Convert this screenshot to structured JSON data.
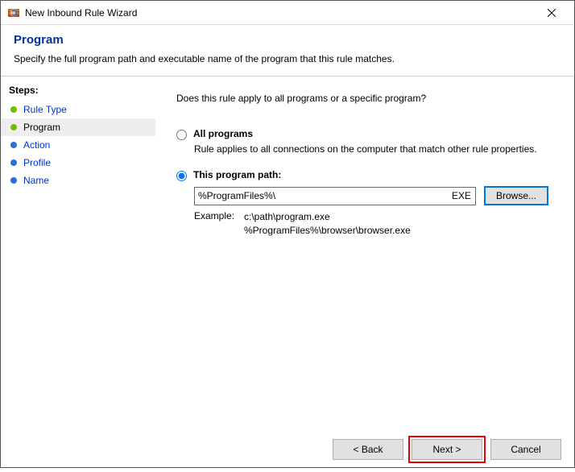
{
  "window": {
    "title": "New Inbound Rule Wizard"
  },
  "header": {
    "title": "Program",
    "description": "Specify the full program path and executable name of the program that this rule matches."
  },
  "steps": {
    "label": "Steps:",
    "items": [
      {
        "label": "Rule Type",
        "state": "done"
      },
      {
        "label": "Program",
        "state": "current"
      },
      {
        "label": "Action",
        "state": "future"
      },
      {
        "label": "Profile",
        "state": "future"
      },
      {
        "label": "Name",
        "state": "future"
      }
    ]
  },
  "content": {
    "question": "Does this rule apply to all programs or a specific program?",
    "option_all": {
      "label": "All programs",
      "sub": "Rule applies to all connections on the computer that match other rule properties."
    },
    "option_path": {
      "label": "This program path:",
      "value": "%ProgramFiles%\\",
      "ext": "EXE",
      "browse": "Browse...",
      "example_label": "Example:",
      "example_line1": "c:\\path\\program.exe",
      "example_line2": "%ProgramFiles%\\browser\\browser.exe"
    }
  },
  "buttons": {
    "back": "< Back",
    "next": "Next >",
    "cancel": "Cancel"
  }
}
